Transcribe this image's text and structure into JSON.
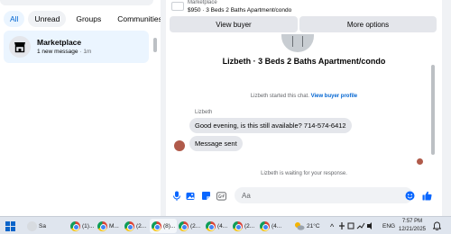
{
  "filters": {
    "all": "All",
    "unread": "Unread",
    "groups": "Groups",
    "communities": "Communities"
  },
  "conversation_list": [
    {
      "title": "Marketplace",
      "subtitle": "1 new message",
      "time": "· 1m",
      "icon": "storefront-icon"
    }
  ],
  "listing": {
    "label": "Marketplace",
    "title": "$950 · 3 Beds 2 Baths Apartment/condo"
  },
  "actions": {
    "view_buyer": "View buyer",
    "more_options": "More options"
  },
  "chat": {
    "title": "Lizbeth · 3 Beds 2 Baths Apartment/condo",
    "started_text": "Lizbeth started this chat.",
    "view_buyer_profile": "View buyer profile",
    "sender_name": "Lizbeth",
    "messages": [
      {
        "text": "Good evening, is this still available? 714-574-6412"
      },
      {
        "text": "Message sent"
      }
    ],
    "waiting_text": "Lizbeth is waiting for your response."
  },
  "composer": {
    "placeholder": "Aa",
    "icons": [
      "microphone-icon",
      "photo-icon",
      "sticker-icon",
      "gif-icon",
      "emoji-icon",
      "thumbs-up-icon"
    ]
  },
  "taskbar": {
    "items": [
      {
        "label": "Sa",
        "icon": "weather-icon"
      },
      {
        "label": "(1)...",
        "icon": "chrome-icon"
      },
      {
        "label": "M...",
        "icon": "chrome-icon"
      },
      {
        "label": "(2...",
        "icon": "chrome-icon"
      },
      {
        "label": "(8)...",
        "icon": "chrome-icon"
      },
      {
        "label": "(2...",
        "icon": "chrome-icon"
      },
      {
        "label": "(4...",
        "icon": "chrome-icon"
      },
      {
        "label": "(2...",
        "icon": "chrome-icon"
      },
      {
        "label": "(4...",
        "icon": "chrome-icon"
      }
    ],
    "temperature": "21°C",
    "language": "ENG",
    "time": "7:57 PM",
    "date": "12/21/2025"
  },
  "colors": {
    "accent": "#0064d1",
    "bubble": "#e4e6eb",
    "chip_active_bg": "#ebf5ff",
    "page_bg": "#f0f2f5"
  }
}
